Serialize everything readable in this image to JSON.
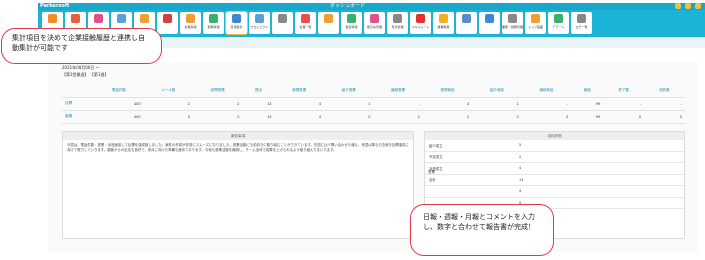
{
  "header": {
    "logo": "Parkersoft",
    "title": "ダッシュボード"
  },
  "nav": [
    {
      "label": "",
      "color": "#f28c28"
    },
    {
      "label": "",
      "color": "#e06040"
    },
    {
      "label": "",
      "color": "#e0508a"
    },
    {
      "label": "",
      "color": "#5aa0d8"
    },
    {
      "label": "",
      "color": "#f0a030"
    },
    {
      "label": "",
      "color": "#d04040"
    },
    {
      "label": "社員情報",
      "color": "#f0a030"
    },
    {
      "label": "勤務情報",
      "color": "#3ab070"
    },
    {
      "label": "日報集計",
      "color": "#3a8ad0"
    },
    {
      "label": "プロジェクト",
      "color": "#5aa0d8"
    },
    {
      "label": "",
      "color": "#888888"
    },
    {
      "label": "社員一覧",
      "color": "#e05050"
    },
    {
      "label": "",
      "color": "#f0a030"
    },
    {
      "label": "自社情報",
      "color": "#3ab070"
    },
    {
      "label": "取引先管理",
      "color": "#e0508a"
    },
    {
      "label": "月次管理",
      "color": "#888888"
    },
    {
      "label": "スキルシート",
      "color": "#e03030"
    },
    {
      "label": "経費精算",
      "color": "#f0b020"
    },
    {
      "label": "",
      "color": "#5a8ad0"
    },
    {
      "label": "",
      "color": "#3a8ad0"
    },
    {
      "label": "業務・勤務管理",
      "color": "#888888"
    },
    {
      "label": "トップ画面",
      "color": "#f0a030"
    },
    {
      "label": "アラート",
      "color": "#3ab070"
    },
    {
      "label": "ログ一覧",
      "color": "#888888"
    }
  ],
  "period": {
    "range": "2021年08月06日 〜",
    "type": "【第3営業週】 【第1週】"
  },
  "table": {
    "headers": [
      "",
      "電話件数",
      "メール数",
      "訪問営業",
      "提出",
      "新規営業",
      "紹介営業",
      "継続営業",
      "新規商談",
      "紹介商談",
      "継続商談",
      "面接",
      "終了数",
      "成約数"
    ],
    "rows": [
      {
        "label": "目標",
        "values": [
          "400",
          "2",
          "2",
          "14",
          "4",
          "1",
          "-",
          "4",
          "1",
          "-",
          "99",
          "-",
          "-"
        ]
      },
      {
        "label": "実績",
        "values": [
          "400",
          "0",
          "0",
          "15",
          "4",
          "0",
          "2",
          "2",
          "0",
          "0",
          "99",
          "0",
          "0"
        ]
      }
    ]
  },
  "notes": {
    "title": "報告事項",
    "text": "今週は、電話件数・営業・派遣面接して目標を達成致しました。案件の作成が非常にスムーズになりました。営業活動にも前向きに取り組むことができています。先週に比べ問い合わせも増え、来週以降も引き続き目標達成に向けて努力していきます。顧客からの反応も良好で、来月に向けた準備も進めております。今後も営業活動を継続し、チーム全体で成果を上げられるよう取り組んでまいります。"
  },
  "summary": {
    "title": "成約詳細",
    "category": "営業",
    "rows": [
      {
        "k": "紹介成立",
        "v": "5"
      },
      {
        "k": "予定成立",
        "v": "2"
      },
      {
        "k": "派遣成立",
        "v": "4"
      },
      {
        "k": "合計",
        "v": "13"
      },
      {
        "k": "",
        "v": "4"
      },
      {
        "k": "",
        "v": "0"
      }
    ]
  },
  "callouts": {
    "c1": "集計項目を決めて企業接触履歴と連携し自動集計が可能です",
    "c2": "日報・週報・月報とコメントを入力し、数字と合わせて報告書が完成！"
  }
}
